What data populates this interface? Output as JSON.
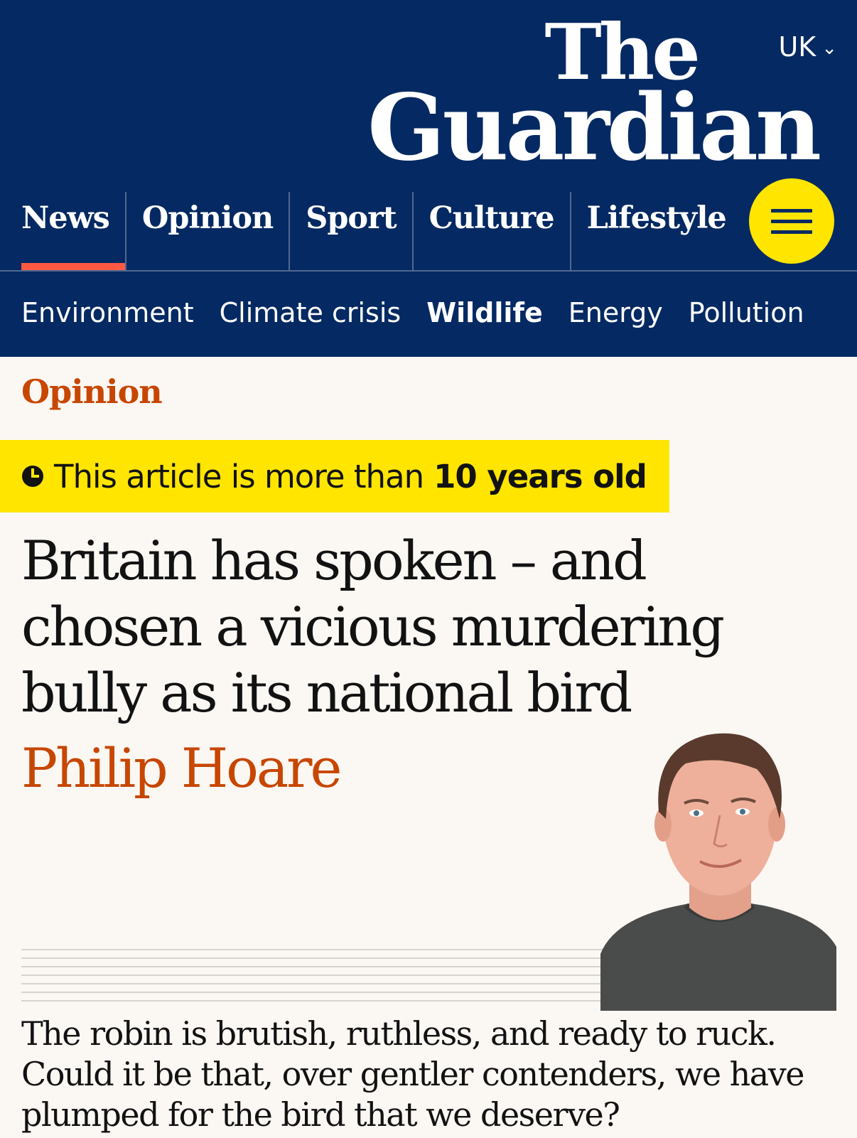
{
  "header": {
    "logo_line1": "The",
    "logo_line2": "Guardian",
    "edition": "UK",
    "edition_icon": "chevron-down-icon",
    "menu_icon": "hamburger-menu-icon"
  },
  "pillars": [
    {
      "label": "News",
      "active": true
    },
    {
      "label": "Opinion",
      "active": false
    },
    {
      "label": "Sport",
      "active": false
    },
    {
      "label": "Culture",
      "active": false
    },
    {
      "label": "Lifestyle",
      "active": false
    }
  ],
  "subnav": [
    {
      "label": "Environment",
      "active": false
    },
    {
      "label": "Climate crisis",
      "active": false
    },
    {
      "label": "Wildlife",
      "active": true
    },
    {
      "label": "Energy",
      "active": false
    },
    {
      "label": "Pollution",
      "active": false
    }
  ],
  "article": {
    "kicker": "Opinion",
    "age_notice_prefix": "This article is more than",
    "age_notice_strong": "10 years old",
    "headline": "Britain has spoken – and chosen a vicious murdering bully as its national bird",
    "byline": "Philip Hoare",
    "standfirst": "The robin is brutish, ruthless, and ready to ruck. Could it be that, over gentler contenders, we have plumped for the bird that we deserve?"
  },
  "colors": {
    "brand_blue": "#052962",
    "news_red": "#ff5943",
    "opinion_orange": "#c74600",
    "highlight_yellow": "#ffe500",
    "background": "#fbf7f3"
  }
}
